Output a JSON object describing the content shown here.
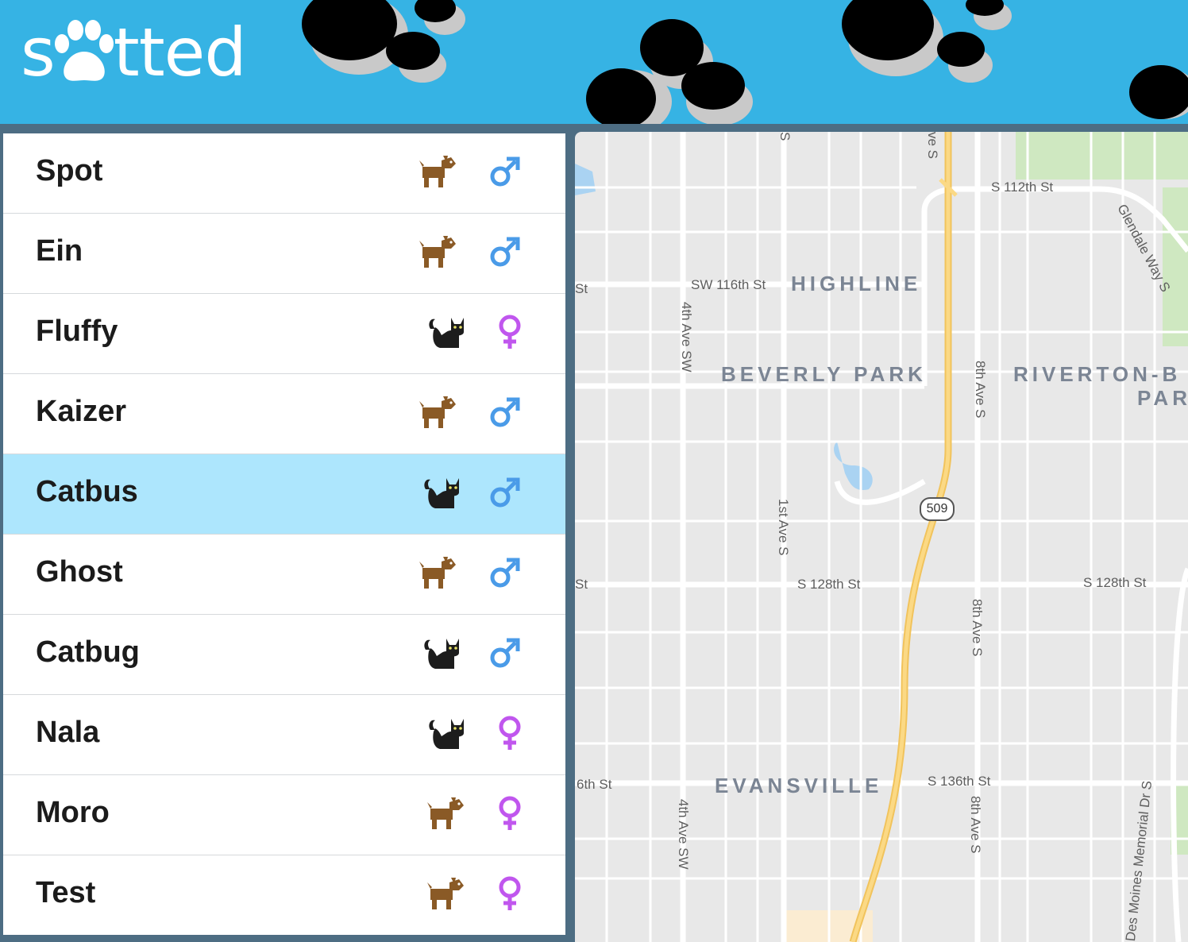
{
  "app": {
    "logo_text_left": "s",
    "logo_text_right": "tted",
    "logo_icon": "paw-icon",
    "header_color": "#36b3e4"
  },
  "pets": [
    {
      "name": "Spot",
      "species": "dog",
      "gender": "male",
      "selected": false
    },
    {
      "name": "Ein",
      "species": "dog",
      "gender": "male",
      "selected": false
    },
    {
      "name": "Fluffy",
      "species": "cat",
      "gender": "female",
      "selected": false
    },
    {
      "name": "Kaizer",
      "species": "dog",
      "gender": "male",
      "selected": false
    },
    {
      "name": "Catbus",
      "species": "cat",
      "gender": "male",
      "selected": true
    },
    {
      "name": "Ghost",
      "species": "dog",
      "gender": "male",
      "selected": false
    },
    {
      "name": "Catbug",
      "species": "cat",
      "gender": "male",
      "selected": false
    },
    {
      "name": "Nala",
      "species": "cat",
      "gender": "female",
      "selected": false
    },
    {
      "name": "Moro",
      "species": "dog",
      "gender": "female",
      "selected": false
    },
    {
      "name": "Test",
      "species": "dog",
      "gender": "female",
      "selected": false
    }
  ],
  "colors": {
    "male": "#4a9be8",
    "female": "#c056ee",
    "dog": "#8a5a26",
    "cat": "#1d1d1d",
    "selected_row": "#ade6fd"
  },
  "map": {
    "areas": {
      "highline": "HIGHLINE",
      "beverly_park": "BEVERLY PARK",
      "riverton_1": "RIVERTON-B",
      "riverton_2": "PAR",
      "evansville": "EVANSVILLE"
    },
    "streets": {
      "s112": "S 112th St",
      "sw116": "SW 116th St",
      "s128a": "S 128th St",
      "s128b": "S 128th St",
      "s136": "S 136th St",
      "st1": "St",
      "st2": "St",
      "th6": "6th St",
      "ave4a": "4th Ave SW",
      "ave4b": "4th Ave SW",
      "ave1": "1st Ave S",
      "ave8a": "8th Ave S",
      "ave8b": "8th Ave S",
      "ave8c": "8th Ave S",
      "glendale": "Glendale Way S",
      "desmoines": "Des Moines Memorial Dr S",
      "top_s": "S",
      "top_ave": "ve S"
    },
    "highway": "509"
  }
}
